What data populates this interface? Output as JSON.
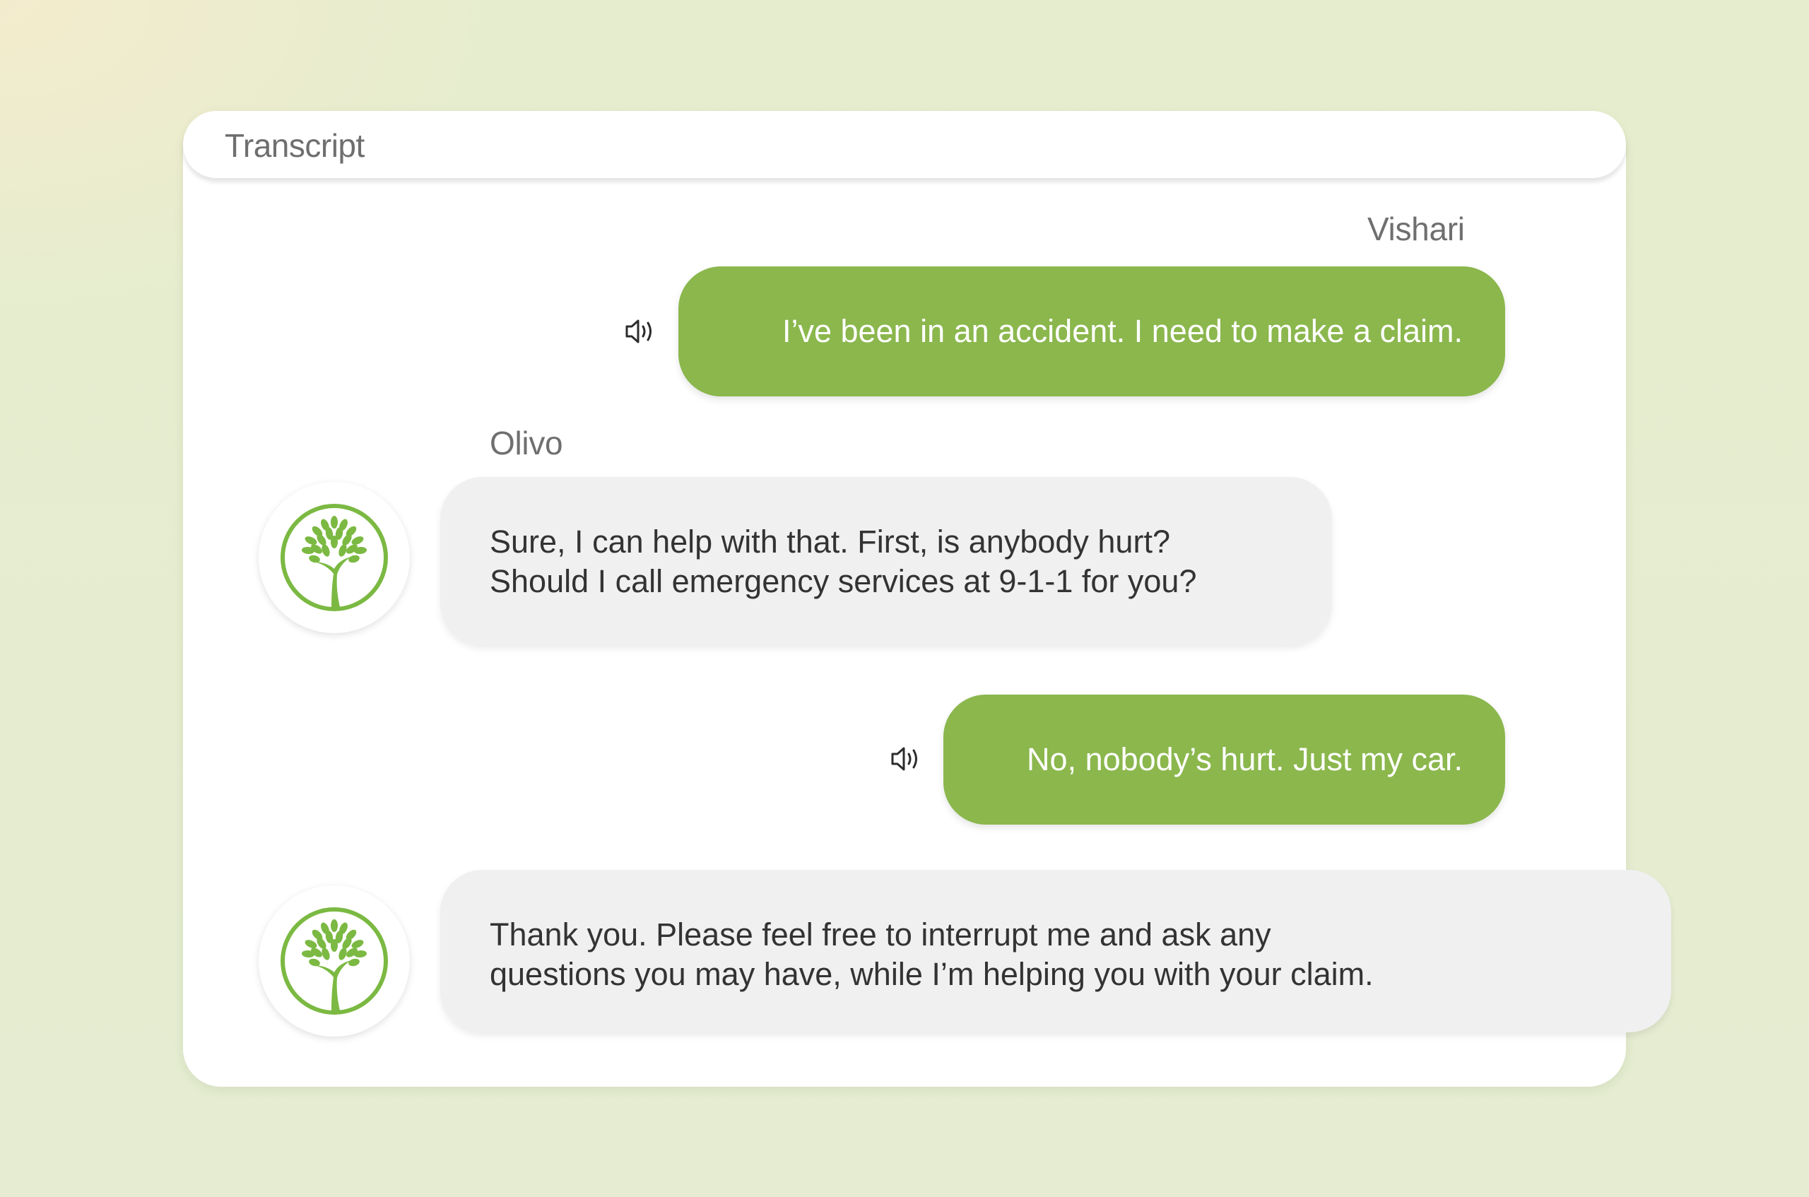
{
  "transcript": {
    "title": "Transcript"
  },
  "messages": [
    {
      "speaker": "Vishari",
      "role": "user",
      "text": "I’ve been in an accident. I need to make a claim.",
      "icon": "speaker-audio-icon"
    },
    {
      "speaker": "Olivo",
      "role": "agent",
      "text": "Sure, I can help with that. First, is anybody hurt?\nShould I call emergency services at 9-1-1 for you?",
      "icon": "tree-logo-icon"
    },
    {
      "speaker": "",
      "role": "user",
      "text": "No, nobody’s hurt. Just my car.",
      "icon": "speaker-audio-icon"
    },
    {
      "speaker": "",
      "role": "agent",
      "text": "Thank you. Please feel free to interrupt me and ask any\nquestions you may have, while I’m helping you with your claim.",
      "icon": "tree-logo-icon"
    }
  ],
  "colors": {
    "user_bubble": "#8bb74d",
    "agent_bubble": "#f0f0f0",
    "brand_green": "#7bb942",
    "text_dark": "#333333",
    "text_muted": "#6f6f6f"
  }
}
